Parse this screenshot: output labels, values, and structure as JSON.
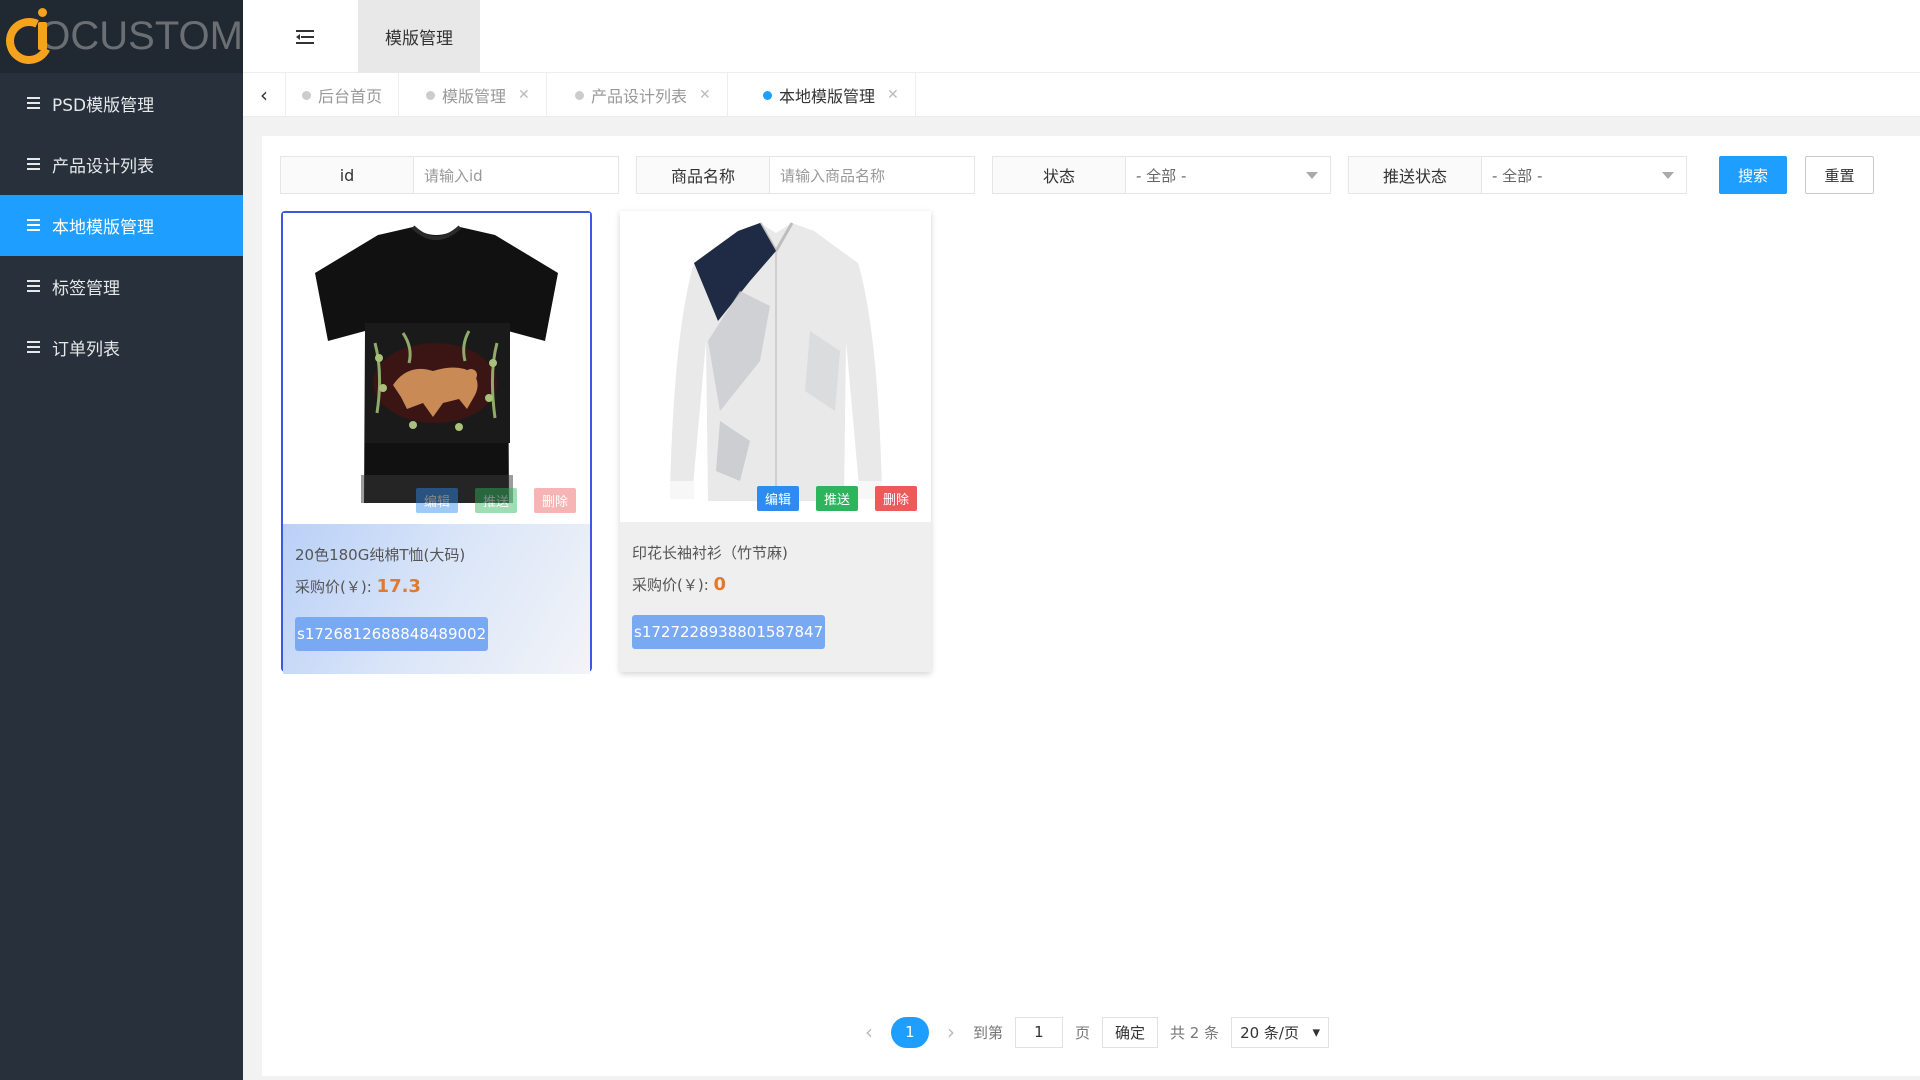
{
  "logo": {
    "text": "OCUSTOM"
  },
  "sidebar": {
    "items": [
      {
        "label": "PSD模版管理",
        "active": false
      },
      {
        "label": "产品设计列表",
        "active": false
      },
      {
        "label": "本地模版管理",
        "active": true
      },
      {
        "label": "标签管理",
        "active": false
      },
      {
        "label": "订单列表",
        "active": false
      }
    ]
  },
  "header": {
    "tab_label": "模版管理"
  },
  "tabs": [
    {
      "label": "后台首页",
      "closable": false,
      "active": false
    },
    {
      "label": "模版管理",
      "closable": true,
      "active": false
    },
    {
      "label": "产品设计列表",
      "closable": true,
      "active": false
    },
    {
      "label": "本地模版管理",
      "closable": true,
      "active": true
    }
  ],
  "filters": {
    "id": {
      "label": "id",
      "placeholder": "请输入id"
    },
    "name": {
      "label": "商品名称",
      "placeholder": "请输入商品名称"
    },
    "status": {
      "label": "状态",
      "value": "- 全部 -"
    },
    "push_status": {
      "label": "推送状态",
      "value": "- 全部 -"
    },
    "search_label": "搜索",
    "reset_label": "重置"
  },
  "cards": [
    {
      "title": "20色180G纯棉T恤(大码)",
      "price_label": "采购价(￥):",
      "price": "17.3",
      "sku": "s1726812688848489002",
      "edit": "编辑",
      "push": "推送",
      "delete": "删除",
      "image": "black-tshirt-print"
    },
    {
      "title": "印花长袖衬衫（竹节麻)",
      "price_label": "采购价(￥):",
      "price": "0",
      "sku": "s1727228938801587847",
      "edit": "编辑",
      "push": "推送",
      "delete": "删除",
      "image": "white-longsleeve-shirt"
    }
  ],
  "pagination": {
    "current": "1",
    "goto_label": "到第",
    "goto_value": "1",
    "page_label": "页",
    "confirm": "确定",
    "total": "共 2 条",
    "page_size": "20 条/页"
  },
  "colors": {
    "accent": "#1e9fff",
    "sidebar": "#28303b",
    "edit": "#2d8cf0",
    "push": "#2db55d",
    "delete": "#ee5a5a",
    "price": "#e07a31"
  }
}
